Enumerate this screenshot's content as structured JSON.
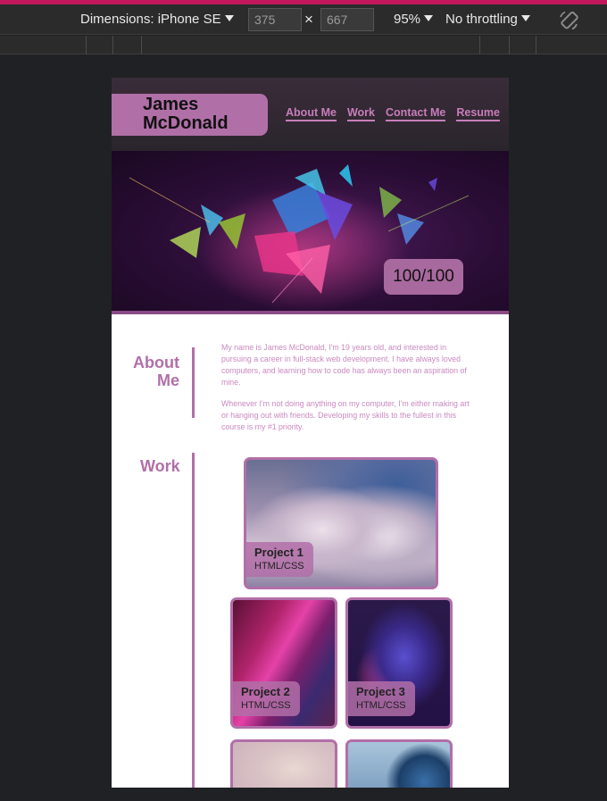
{
  "devtools": {
    "dimensions_label": "Dimensions: iPhone SE",
    "width": "375",
    "times": "×",
    "height": "667",
    "zoom": "95%",
    "throttling": "No throttling"
  },
  "site": {
    "name": "James McDonald",
    "nav": [
      "About Me",
      "Work",
      "Contact Me",
      "Resume"
    ],
    "score": "100/100",
    "about": {
      "title": "About Me",
      "paragraphs": [
        "My name is James McDonald, I'm 19 years old, and interested in pursuing a career in full-stack web development. I have always loved computers, and learning how to code has always been an aspiration of mine.",
        "Whenever I'm not doing anything on my computer, I'm either making art or hanging out with friends. Developing my skills to the fullest in this course is my #1 priority."
      ]
    },
    "work": {
      "title": "Work",
      "projects": [
        {
          "title": "Project 1",
          "stack": "HTML/CSS"
        },
        {
          "title": "Project 2",
          "stack": "HTML/CSS"
        },
        {
          "title": "Project 3",
          "stack": "HTML/CSS"
        }
      ]
    }
  },
  "colors": {
    "accent": "#b16fa8",
    "devtools_bg": "#202124",
    "devtools_accent": "#c2185b"
  }
}
